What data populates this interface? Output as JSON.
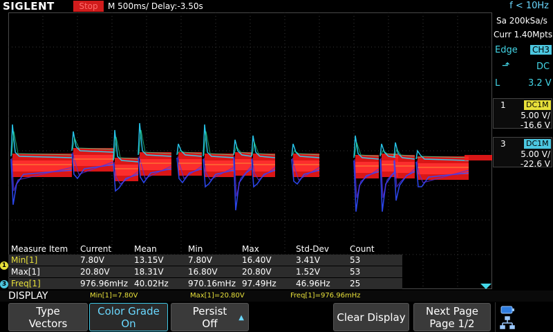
{
  "topbar": {
    "brand": "SIGLENT",
    "run_state": "Stop",
    "timebase": "M 500ms/  Delay:-3.50s",
    "trigger_freq": "f < 10Hz"
  },
  "acquisition": {
    "sample_rate": "Sa 200kSa/s",
    "memory": "Curr 1.40Mpts"
  },
  "trigger": {
    "type": "Edge",
    "source": "CH3",
    "coupling": "DC",
    "level_label": "L",
    "level": "3.2 V"
  },
  "channels": [
    {
      "number": "1",
      "coupling": "DC1M",
      "scale": "5.00 V/",
      "offset": "-16.6 V",
      "color": "#e7e03a"
    },
    {
      "number": "3",
      "coupling": "DC1M",
      "scale": "5.00 V/",
      "offset": "-22.6 V",
      "color": "#4cc7e0"
    }
  ],
  "measure": {
    "headers": [
      "Measure Item",
      "Current",
      "Mean",
      "Min",
      "Max",
      "Std-Dev",
      "Count"
    ],
    "rows": [
      {
        "name": "Min[1]",
        "values": [
          "7.80V",
          "13.15V",
          "7.80V",
          "16.40V",
          "3.41V",
          "53"
        ]
      },
      {
        "name": "Max[1]",
        "values": [
          "20.80V",
          "18.31V",
          "16.80V",
          "20.80V",
          "1.52V",
          "53"
        ]
      },
      {
        "name": "Freq[1]",
        "values": [
          "976.96mHz",
          "40.02Hz",
          "970.16mHz",
          "97.49Hz",
          "46.96Hz",
          "25"
        ]
      }
    ]
  },
  "status": {
    "menu_title": "DISPLAY",
    "min_value": "Min[1]=7.80V",
    "max_value": "Max[1]=20.80V",
    "freq_value": "Freq[1]=976.96mHz"
  },
  "softkeys": {
    "type_l1": "Type",
    "type_l2": "Vectors",
    "color_l1": "Color Grade",
    "color_l2": "On",
    "persist_l1": "Persist",
    "persist_l2": "Off",
    "clear": "Clear Display",
    "next_l1": "Next Page",
    "next_l2": "Page 1/2"
  },
  "markers": {
    "ch1": "1",
    "ch3": "3"
  },
  "colors": {
    "accent": "#44d7e8",
    "ch1": "#e7e03a",
    "stop": "#d11c1c"
  }
}
